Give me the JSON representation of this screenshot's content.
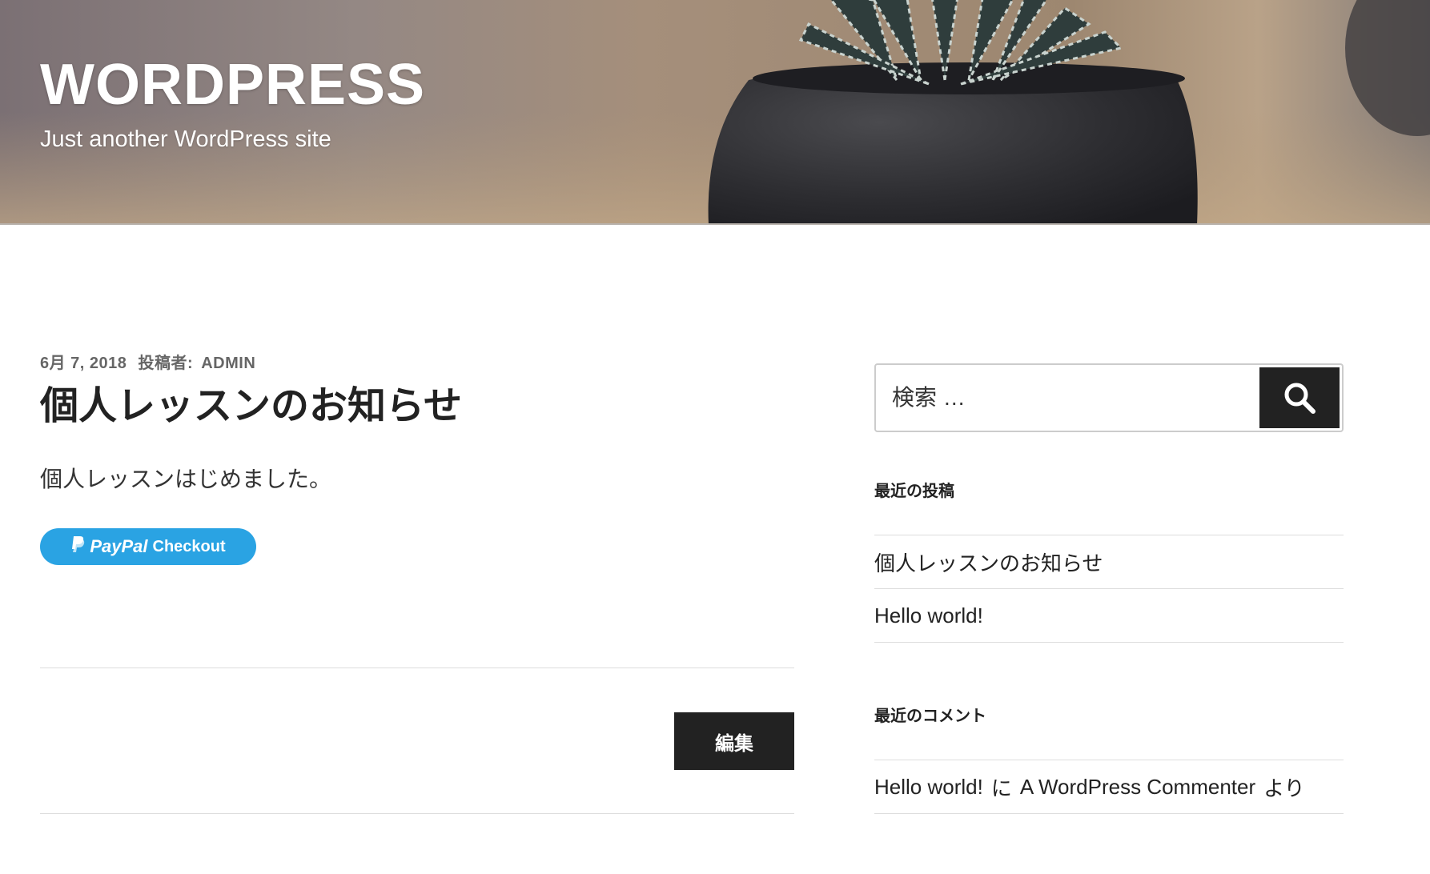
{
  "header": {
    "site_title": "WORDPRESS",
    "site_description": "Just another WordPress site"
  },
  "post": {
    "date": "6月 7, 2018",
    "author_prefix": "投稿者:",
    "author": "ADMIN",
    "title": "個人レッスンのお知らせ",
    "content": "個人レッスンはじめました。",
    "paypal": {
      "brand": "PayPal",
      "label": "Checkout",
      "icon": "paypal-p-icon",
      "color": "#2aa3e3"
    },
    "edit_label": "編集"
  },
  "sidebar": {
    "search": {
      "placeholder": "検索 …",
      "button_icon": "search-icon"
    },
    "recent_posts": {
      "title": "最近の投稿",
      "items": [
        "個人レッスンのお知らせ",
        "Hello world!"
      ]
    },
    "recent_comments": {
      "title": "最近のコメント",
      "items": [
        {
          "post": "Hello world!",
          "connector_1": "に",
          "author": "A WordPress Commenter",
          "connector_2": "より"
        }
      ]
    }
  },
  "colors": {
    "button_dark": "#222222",
    "paypal_blue": "#2aa3e3",
    "divider": "#dddddd"
  }
}
